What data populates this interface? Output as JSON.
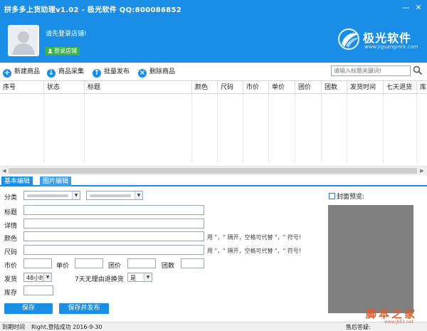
{
  "window": {
    "title": "拼多多上货助理v1.02 - 极光软件 QQ:800086852",
    "minimize_glyph": "—",
    "close_glyph": "✕"
  },
  "header": {
    "login_prompt": "请先登录店铺!",
    "login_button": "登录店铺",
    "brand_name": "极光软件",
    "brand_url": "www.jiguangmrk.com"
  },
  "toolbar": {
    "buttons": [
      {
        "label": "新建商品",
        "icon": "plus-icon",
        "color": "#1a8ee6"
      },
      {
        "label": "商品采集",
        "icon": "download-icon",
        "color": "#1a8ee6"
      },
      {
        "label": "批量发布",
        "icon": "upload-icon",
        "color": "#1a8ee6"
      },
      {
        "label": "删除商品",
        "icon": "delete-icon",
        "color": "#1a8ee6"
      }
    ],
    "search_placeholder": "请输入标题关键词!"
  },
  "grid": {
    "columns": [
      "序号",
      "状态",
      "标题",
      "颜色",
      "尺码",
      "市价",
      "单价",
      "团价",
      "团数",
      "发货时间",
      "七天退货",
      "库"
    ]
  },
  "tabs": {
    "basic": "基本编辑",
    "image": "图片编辑"
  },
  "form": {
    "category_label": "分类",
    "title_label": "标题",
    "detail_label": "详情",
    "color_label": "颜色",
    "color_hint": "用 \"，\" 隔开，空格可代替 \"，\" 符号!",
    "size_label": "尺码",
    "size_hint": "用 \"，\" 隔开，空格可代替 \"，\" 符号!",
    "market_price_label": "市价",
    "unit_price_label": "单价",
    "group_price_label": "团价",
    "group_count_label": "团数",
    "ship_label": "发货",
    "ship_value": "48小时",
    "return_label": "7天无理由退换货",
    "return_value": "是",
    "stock_label": "库存",
    "save_button": "保存",
    "save_publish_button": "保存并发布",
    "cover_preview_label": "封面预览:"
  },
  "status": {
    "expire_label": "到期时间",
    "message": "Right,登陆成功 2016-9-30",
    "after_sales": "售后答疑:"
  },
  "watermark": {
    "site_name": "脚本之家",
    "url": "www.jb51.net"
  },
  "colors": {
    "accent": "#1a8ee6",
    "login_green": "#3bb34a",
    "preview_gray": "#808080"
  }
}
